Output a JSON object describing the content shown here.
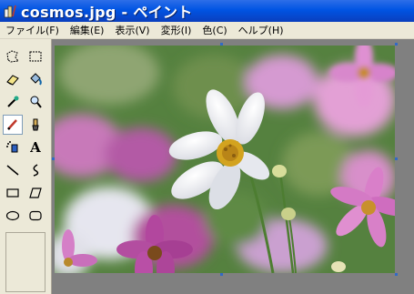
{
  "window": {
    "title": "cosmos.jpg - ペイント"
  },
  "menu": [
    "ファイル(F)",
    "編集(E)",
    "表示(V)",
    "変形(I)",
    "色(C)",
    "ヘルプ(H)"
  ],
  "tools": [
    {
      "name": "free-select-icon"
    },
    {
      "name": "rect-select-icon"
    },
    {
      "name": "eraser-icon"
    },
    {
      "name": "fill-bucket-icon"
    },
    {
      "name": "eyedropper-icon"
    },
    {
      "name": "magnifier-icon"
    },
    {
      "name": "pencil-icon",
      "active": true
    },
    {
      "name": "brush-icon"
    },
    {
      "name": "airbrush-icon"
    },
    {
      "name": "text-icon",
      "glyph": "A"
    },
    {
      "name": "line-icon"
    },
    {
      "name": "curve-icon"
    },
    {
      "name": "rectangle-icon"
    },
    {
      "name": "polygon-icon"
    },
    {
      "name": "ellipse-icon"
    },
    {
      "name": "rounded-rectangle-icon"
    }
  ],
  "colors": {
    "titlebar": "#0054e3",
    "chrome": "#ece9d8",
    "workspace": "#808080",
    "handle": "#316ac5"
  },
  "canvas": {
    "image": "photo of white and pink cosmos flowers"
  }
}
